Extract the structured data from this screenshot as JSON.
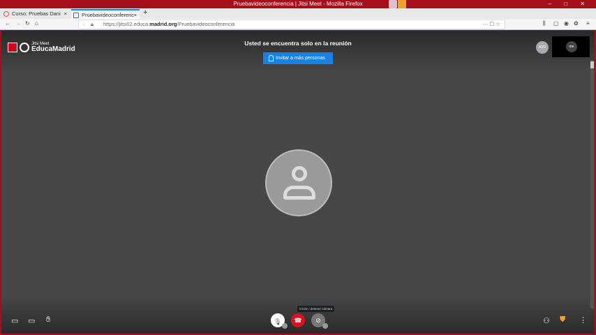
{
  "window": {
    "title": "Pruebavideoconferencia | Jitsi Meet - Mozilla Firefox",
    "controls": "– □ ✕"
  },
  "tabs": [
    {
      "label": "Curso: Pruebas Dani"
    },
    {
      "label": "Pruebavideoconferenc"
    }
  ],
  "tab_close": "×",
  "new_tab": "+",
  "url": {
    "prefix": "https://jitsi02.educa.",
    "domain": "madrid.org",
    "path": "/Pruebavideoconferencia"
  },
  "logo": {
    "small": "Jitsi Meet",
    "big": "EducaMadrid"
  },
  "meeting": {
    "message": "Usted se encuentra solo en la reunión",
    "invite_label": "Invitar a más personas",
    "avatar_initials": "AVD",
    "thumb_label": "me"
  },
  "toolbar": {
    "tooltip": "Iniciar / detener cámara"
  },
  "colors": {
    "titlebar": "#a50e1b",
    "invite": "#1782e3",
    "hangup": "#d7141d"
  }
}
